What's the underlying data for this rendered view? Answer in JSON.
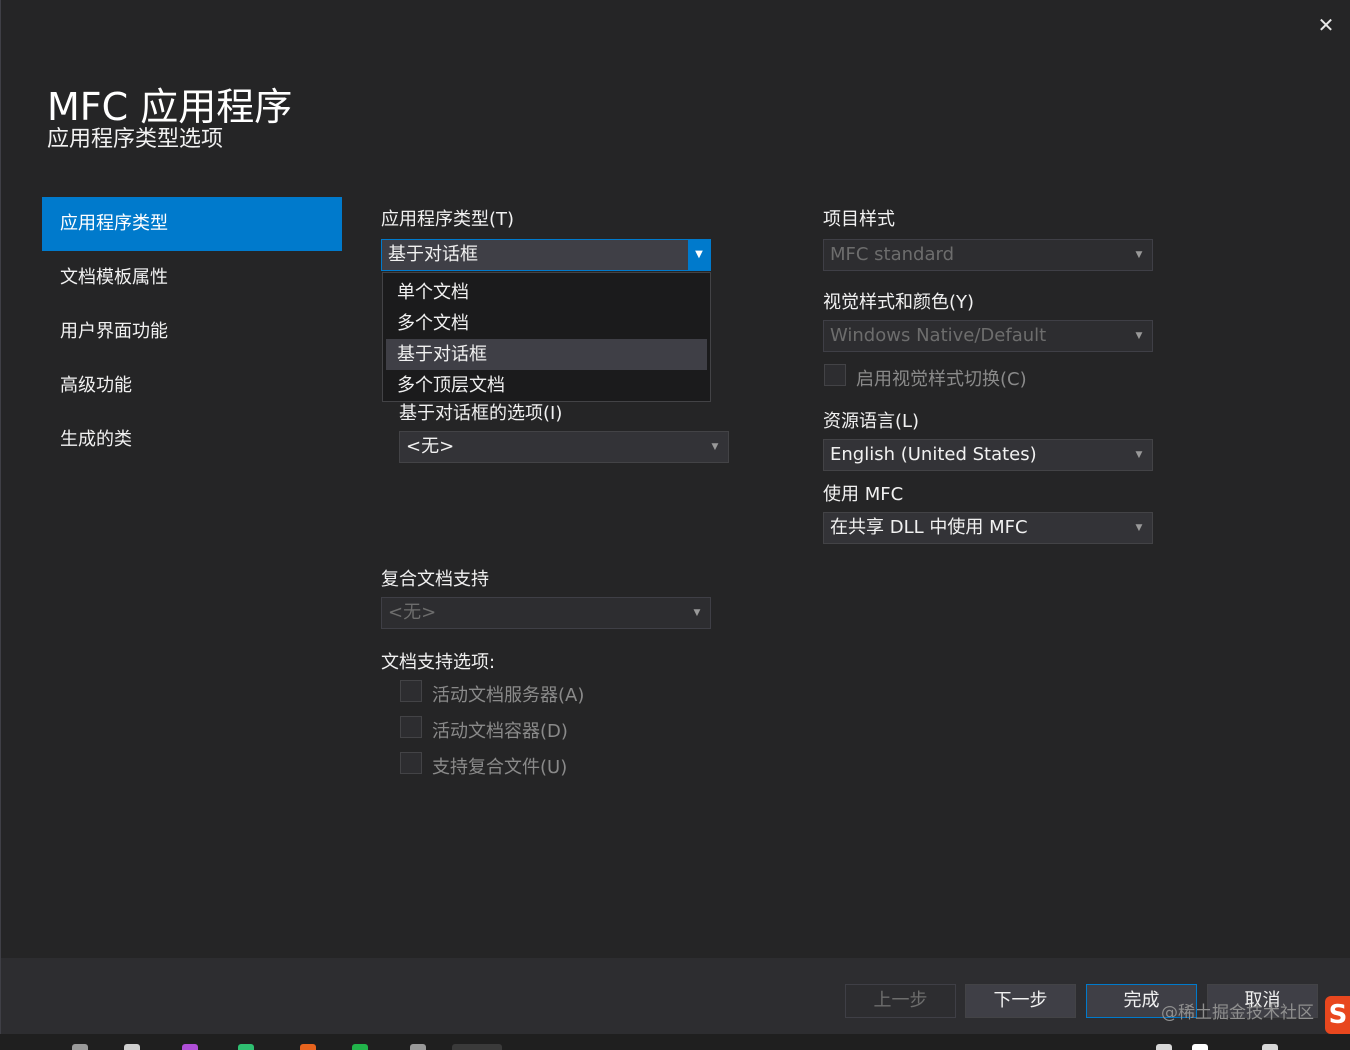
{
  "dialog": {
    "close_glyph": "✕",
    "title": "MFC 应用程序",
    "subtitle": "应用程序类型选项"
  },
  "nav": {
    "items": [
      {
        "label": "应用程序类型",
        "active": true
      },
      {
        "label": "文档模板属性"
      },
      {
        "label": "用户界面功能"
      },
      {
        "label": "高级功能"
      },
      {
        "label": "生成的类"
      }
    ]
  },
  "app_type": {
    "label": "应用程序类型(T)",
    "selected": "基于对话框",
    "options": [
      "单个文档",
      "多个文档",
      "基于对话框",
      "多个顶层文档"
    ]
  },
  "dialog_options": {
    "label": "基于对话框的选项(I)",
    "value": "<无>"
  },
  "compound_doc": {
    "label": "复合文档支持",
    "value": "<无>"
  },
  "doc_support": {
    "label": "文档支持选项:",
    "options": [
      "活动文档服务器(A)",
      "活动文档容器(D)",
      "支持复合文件(U)"
    ]
  },
  "project_style": {
    "label": "项目样式",
    "value": "MFC standard"
  },
  "visual_style": {
    "label": "视觉样式和颜色(Y)",
    "value": "Windows Native/Default",
    "toggle_label": "启用视觉样式切换(C)"
  },
  "resource_lang": {
    "label": "资源语言(L)",
    "value": "English (United States)"
  },
  "use_mfc": {
    "label": "使用 MFC",
    "value": "在共享 DLL 中使用 MFC"
  },
  "footer": {
    "prev": "上一步",
    "next": "下一步",
    "finish": "完成",
    "cancel": "取消"
  },
  "watermark": {
    "text": "@稀土掘金技术社区",
    "logo": "S"
  },
  "colors": {
    "accent": "#007acc",
    "background": "#252526",
    "footer": "#2d2d30"
  }
}
